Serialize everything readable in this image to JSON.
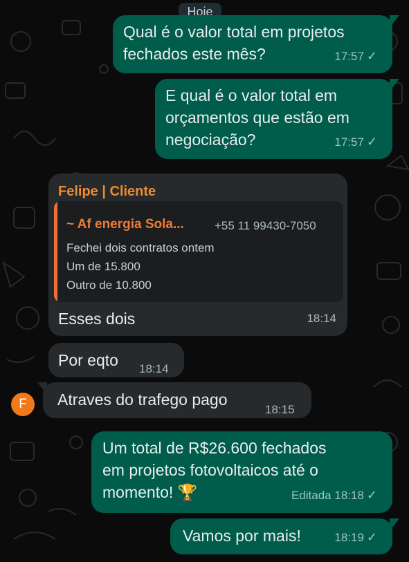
{
  "chat": {
    "date_separator": "Hoje",
    "messages": [
      {
        "text_line1": "Qual é o valor total em projetos",
        "text_line2": "fechados este mês?",
        "time": "17:57",
        "status": "✓"
      },
      {
        "text_line1": "E qual é o valor total em",
        "text_line2": "orçamentos que estão em",
        "text_line3": "negociação?",
        "time": "17:57",
        "status": "✓"
      },
      {
        "sender": "Felipe | Cliente",
        "quoted": {
          "name": "~ Af energia Sola...",
          "phone": "+55 11 99430-7050",
          "lines": [
            "Fechei dois contratos ontem",
            "Um de 15.800",
            "Outro de 10.800"
          ]
        },
        "text": "Esses dois",
        "time": "18:14"
      },
      {
        "text": "Por eqto",
        "time": "18:14"
      },
      {
        "text": "Atraves do trafego pago",
        "time": "18:15",
        "avatar_letter": "F"
      },
      {
        "text_line1": "Um total de R$26.600 fechados",
        "text_line2": "em projetos fotovoltaicos até o",
        "text_line3": "momento! 🏆",
        "edited": "Editada",
        "time": "18:18",
        "status": "✓"
      },
      {
        "text": "Vamos por mais!",
        "time": "18:19",
        "status": "✓"
      }
    ]
  },
  "colors": {
    "background": "#0b0b0b",
    "outgoing_bubble": "#005c4b",
    "incoming_bubble": "#262a2d",
    "sender_name": "#f08a2c",
    "avatar": "#f07a1a"
  }
}
